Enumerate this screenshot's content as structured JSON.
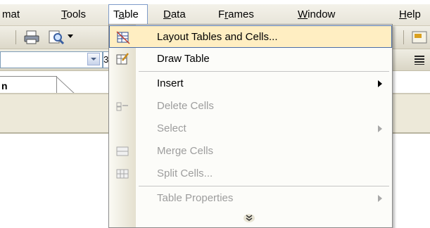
{
  "menubar": {
    "items": [
      {
        "label": "mat",
        "ul": ""
      },
      {
        "label": "Tools",
        "ul": "T"
      },
      {
        "label": "Table",
        "ul": "a"
      },
      {
        "label": "Data",
        "ul": "D"
      },
      {
        "label": "Frames",
        "ul": "r"
      },
      {
        "label": "Window",
        "ul": "W"
      },
      {
        "label": "Help",
        "ul": "H"
      }
    ]
  },
  "toolbar": {
    "font_size_fragment": "3"
  },
  "tab": {
    "label": "n"
  },
  "menu": {
    "items": [
      {
        "label": "Layout Tables and Cells...",
        "icon": "layout-table-icon",
        "state": "highlighted"
      },
      {
        "label": "Draw Table",
        "icon": "draw-table-icon",
        "state": "enabled"
      },
      {
        "label": "Insert",
        "icon": "",
        "state": "enabled",
        "submenu": true
      },
      {
        "label": "Delete Cells",
        "icon": "delete-cells-icon",
        "state": "disabled"
      },
      {
        "label": "Select",
        "icon": "",
        "state": "disabled",
        "submenu": true
      },
      {
        "label": "Merge Cells",
        "icon": "merge-cells-icon",
        "state": "disabled"
      },
      {
        "label": "Split Cells...",
        "icon": "split-cells-icon",
        "state": "disabled"
      },
      {
        "label": "Table Properties",
        "icon": "",
        "state": "disabled",
        "submenu": true
      }
    ],
    "expand_icon": "double-chevron-down-icon"
  },
  "colors": {
    "highlight_bg": "#ffeec2",
    "highlight_border": "#4b6ea8",
    "disabled_text": "#9d9d9d"
  }
}
